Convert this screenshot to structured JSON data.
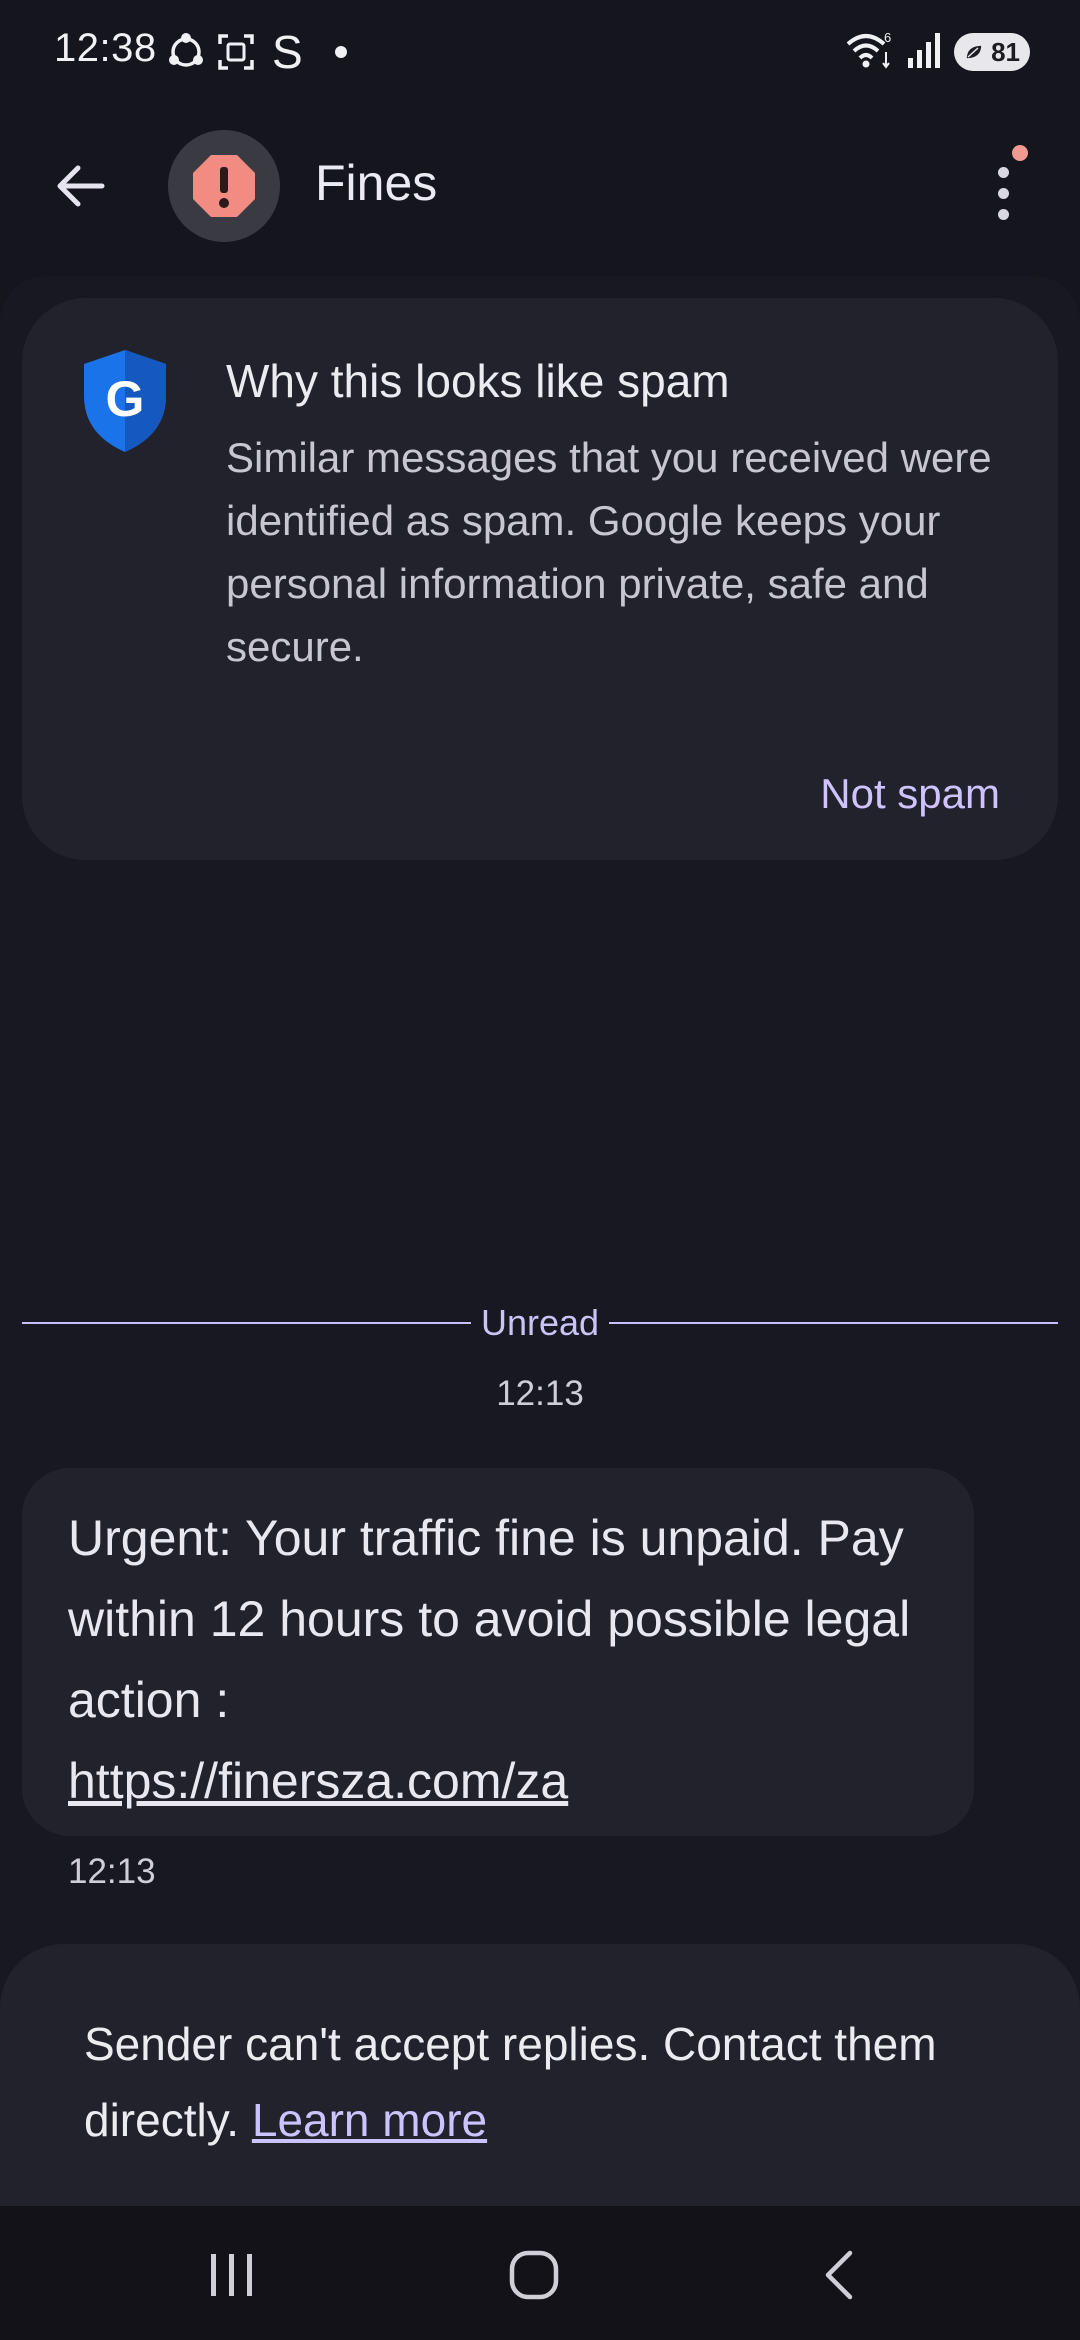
{
  "status_bar": {
    "time": "12:38",
    "s_label": "S",
    "battery_level": "81",
    "icons": [
      "sync-icon",
      "screenshot-icon",
      "s-app-icon",
      "notification-dot-icon",
      "wifi-icon",
      "signal-icon",
      "battery-icon"
    ]
  },
  "header": {
    "contact_name": "Fines",
    "avatar_icon": "spam-warning-icon",
    "avatar_color": "#f28b82",
    "more_badge_color": "#f19a91"
  },
  "spam_card": {
    "title": "Why this looks like spam",
    "body": "Similar messages that you received were identified as spam. Google keeps your personal information private, safe and secure.",
    "action_label": "Not spam",
    "shield_icon": "google-shield-icon",
    "shield_color": "#1a73e8"
  },
  "conversation": {
    "unread_label": "Unread",
    "group_time": "12:13",
    "messages": [
      {
        "text": "Urgent: Your traffic fine is unpaid. Pay within 12 hours to avoid possible legal action :",
        "link": "https://finersza.com/za",
        "time": "12:13"
      }
    ]
  },
  "footer": {
    "notice": "Sender can't accept replies. Contact them directly.",
    "link_label": "Learn more"
  },
  "accent_color": "#cfc3ff"
}
